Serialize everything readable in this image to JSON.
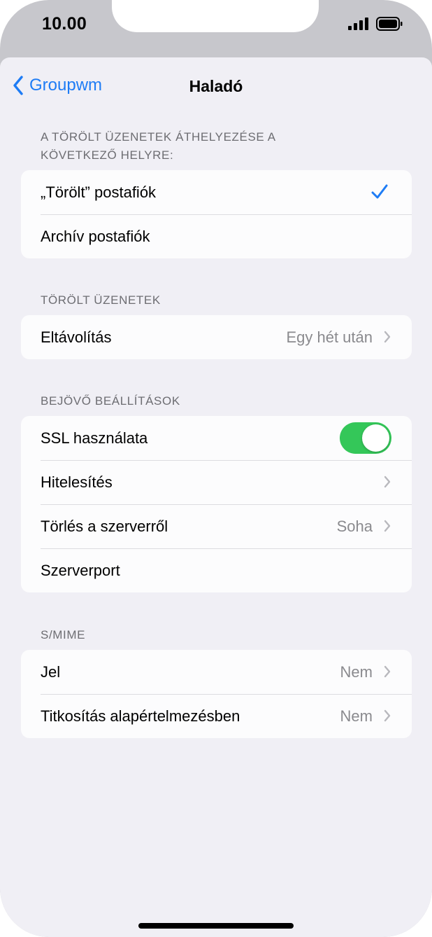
{
  "status_bar": {
    "time": "10.00"
  },
  "nav": {
    "back_label": "Groupwm",
    "title": "Haladó"
  },
  "sections": {
    "move_deleted": {
      "header": "A TÖRÖLT ÜZENETEK ÁTHELYEZÉSE A KÖVETKEZŐ HELYRE:",
      "rows": [
        {
          "label": "„Törölt” postafiók",
          "selected": true
        },
        {
          "label": "Archív postafiók",
          "selected": false
        }
      ]
    },
    "deleted_messages": {
      "header": "TÖRÖLT ÜZENETEK",
      "rows": [
        {
          "label": "Eltávolítás",
          "value": "Egy hét után"
        }
      ]
    },
    "incoming": {
      "header": "BEJÖVŐ BEÁLLÍTÁSOK",
      "rows": [
        {
          "label": "SSL használata",
          "toggle": true
        },
        {
          "label": "Hitelesítés",
          "value": ""
        },
        {
          "label": "Törlés a szerverről",
          "value": "Soha"
        },
        {
          "label": "Szerverport",
          "value": ""
        }
      ]
    },
    "smime": {
      "header": "S/MIME",
      "rows": [
        {
          "label": "Jel",
          "value": "Nem"
        },
        {
          "label": "Titkosítás alapértelmezésben",
          "value": "Nem"
        }
      ]
    }
  },
  "colors": {
    "accent": "#1e7cf5",
    "toggle_on": "#34c759",
    "background": "#f0eff5"
  }
}
